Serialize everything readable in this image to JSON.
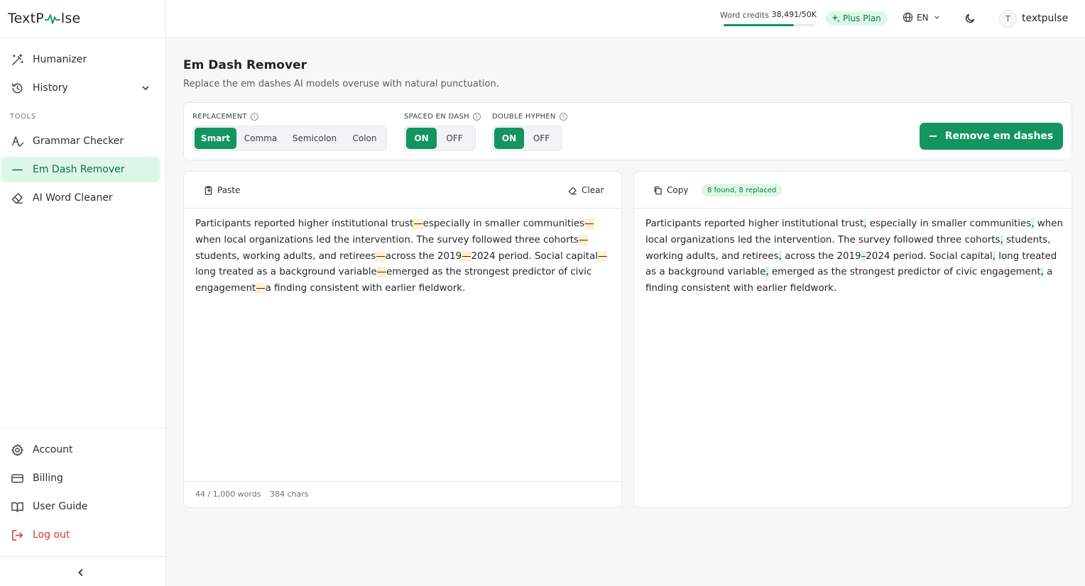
{
  "app": {
    "logo_left": "TextP",
    "logo_right": "lse"
  },
  "sidebar": {
    "main_items": [
      {
        "label": "Humanizer",
        "icon": "magic-wand-icon"
      },
      {
        "label": "History",
        "icon": "history-icon"
      }
    ],
    "section_label": "TOOLS",
    "tools": [
      {
        "label": "Grammar Checker",
        "icon": "spell-check-icon"
      },
      {
        "label": "Em Dash Remover",
        "icon": "dash-icon",
        "active": true
      },
      {
        "label": "AI Word Cleaner",
        "icon": "eraser-icon"
      }
    ],
    "bottom_items": [
      {
        "label": "Account",
        "icon": "gear-icon"
      },
      {
        "label": "Billing",
        "icon": "card-icon"
      },
      {
        "label": "User Guide",
        "icon": "book-icon"
      },
      {
        "label": "Log out",
        "icon": "logout-icon"
      }
    ]
  },
  "topbar": {
    "credits_label": "Word credits",
    "credits_value": "38,491/50K",
    "credits_fraction": 0.77,
    "plan": "Plus Plan",
    "language": "EN",
    "avatar_initial": "T",
    "username": "textpulse"
  },
  "page": {
    "title": "Em Dash Remover",
    "subtitle": "Replace the em dashes AI models overuse with natural punctuation."
  },
  "options": {
    "replacement": {
      "label": "REPLACEMENT",
      "options": [
        "Smart",
        "Comma",
        "Semicolon",
        "Colon"
      ],
      "selected": "Smart"
    },
    "spaced_en_dash": {
      "label": "SPACED EN DASH",
      "options": [
        "ON",
        "OFF"
      ],
      "selected": "ON"
    },
    "double_hyphen": {
      "label": "DOUBLE HYPHEN",
      "options": [
        "ON",
        "OFF"
      ],
      "selected": "ON"
    },
    "action_label": "Remove em dashes"
  },
  "input_panel": {
    "paste_label": "Paste",
    "clear_label": "Clear",
    "segments": [
      "Participants reported higher institutional trust",
      "especially in smaller communities",
      "when local organizations led the intervention. The survey followed three cohorts",
      "students, working adults, and retirees",
      "across the 2019",
      "2024 period. Social capital",
      "long treated as a background variable",
      "emerged as the strongest predictor of civic engagement",
      "a finding consistent with earlier fieldwork."
    ],
    "marks": [
      "—",
      "—",
      "—",
      "—",
      "—",
      "—",
      "—",
      "—"
    ],
    "word_count": "44 / 1,000 words",
    "char_count": "384 chars"
  },
  "output_panel": {
    "copy_label": "Copy",
    "found_badge": "8 found, 8 replaced",
    "segments": [
      "Participants reported higher institutional trust",
      " especially in smaller communities",
      " when local organizations led the intervention. The survey followed three cohorts",
      " students, working adults, and retirees",
      " across the 2019",
      "2024 period. Social capital",
      " long treated as a background variable",
      " emerged as the strongest predictor of civic engagement",
      " a finding consistent with earlier fieldwork."
    ],
    "marks": [
      ",",
      ",",
      ",",
      ",",
      "–",
      ",",
      ",",
      ","
    ]
  },
  "colors": {
    "accent": "#12955f",
    "accent_soft": "#dcf7e8",
    "danger": "#d63a2f"
  }
}
